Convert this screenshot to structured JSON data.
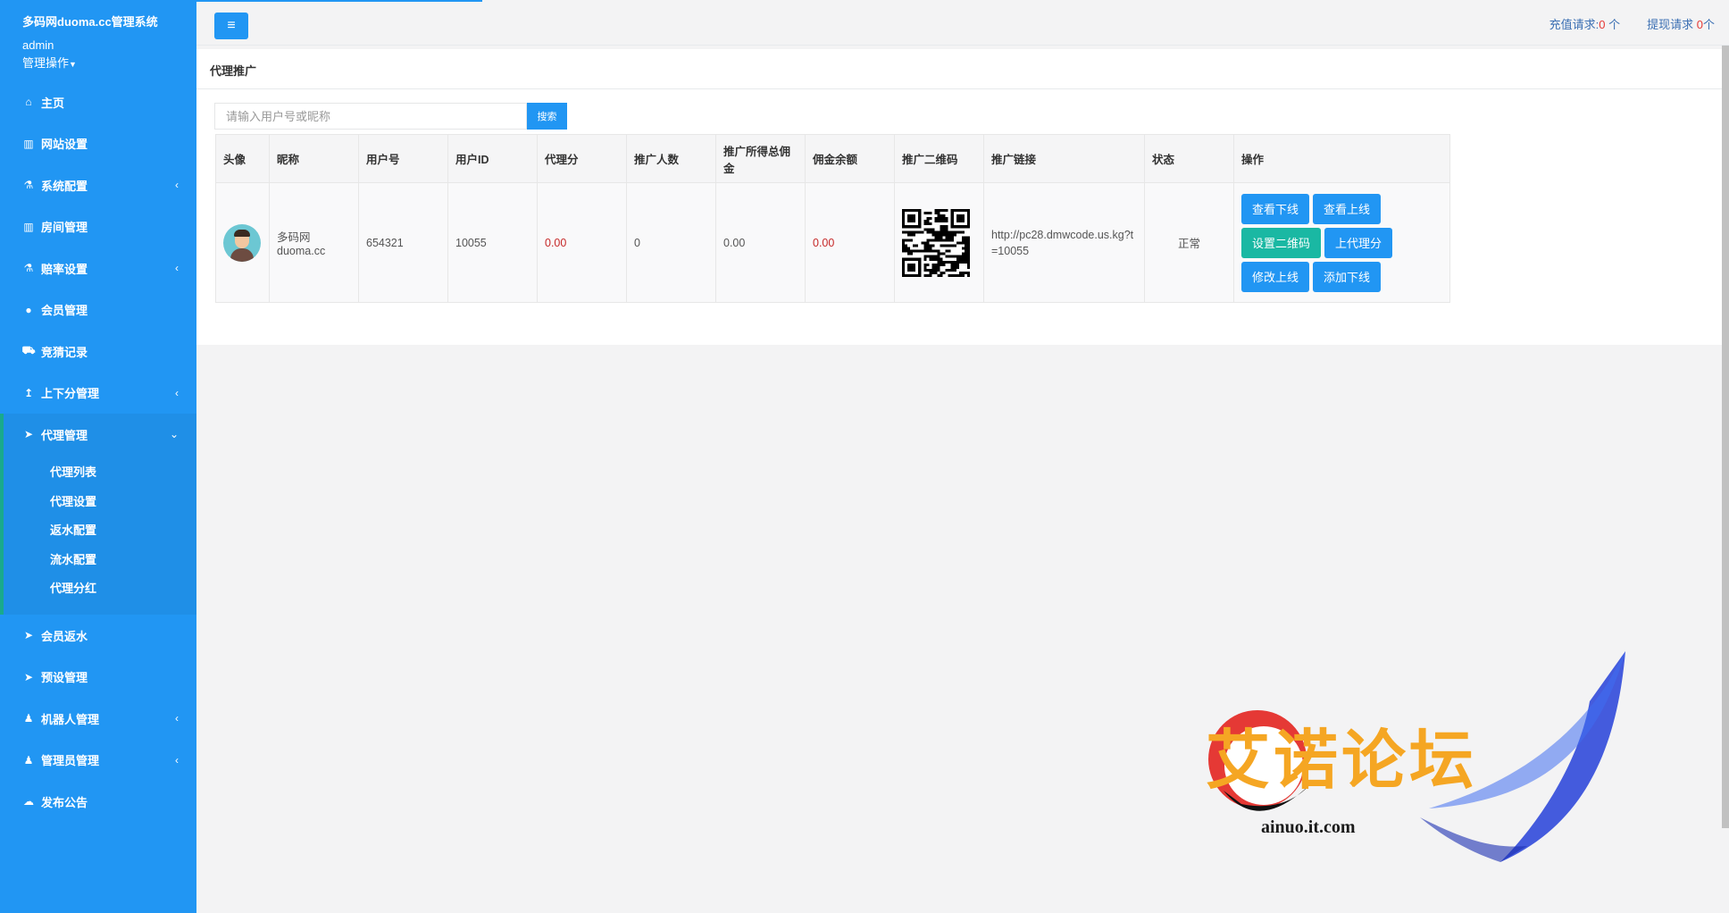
{
  "sidebar": {
    "title": "多码网duoma.cc管理系统",
    "user": "admin",
    "ops_label": "管理操作",
    "items": [
      {
        "label": "主页",
        "icon": "home-icon",
        "glyph": "⌂",
        "chevron": ""
      },
      {
        "label": "网站设置",
        "icon": "columns-icon",
        "glyph": "▥",
        "chevron": ""
      },
      {
        "label": "系统配置",
        "icon": "flask-icon",
        "glyph": "⚗",
        "chevron": "‹"
      },
      {
        "label": "房间管理",
        "icon": "columns-icon",
        "glyph": "▥",
        "chevron": ""
      },
      {
        "label": "赔率设置",
        "icon": "flask-icon",
        "glyph": "⚗",
        "chevron": "‹"
      },
      {
        "label": "会员管理",
        "icon": "user-icon",
        "glyph": "●",
        "chevron": ""
      },
      {
        "label": "竞猜记录",
        "icon": "car-icon",
        "glyph": "⛟",
        "chevron": ""
      },
      {
        "label": "上下分管理",
        "icon": "upload-icon",
        "glyph": "↥",
        "chevron": "‹"
      },
      {
        "label": "代理管理",
        "icon": "paper-plane-icon",
        "glyph": "➤",
        "chevron": "⌄"
      }
    ],
    "sub_items": [
      "代理列表",
      "代理设置",
      "返水配置",
      "流水配置",
      "代理分红"
    ],
    "items_after": [
      {
        "label": "会员返水",
        "icon": "paper-plane-icon",
        "glyph": "➤",
        "chevron": ""
      },
      {
        "label": "预设管理",
        "icon": "paper-plane-icon",
        "glyph": "➤",
        "chevron": ""
      },
      {
        "label": "机器人管理",
        "icon": "male-icon",
        "glyph": "♟",
        "chevron": "‹"
      },
      {
        "label": "管理员管理",
        "icon": "male-icon",
        "glyph": "♟",
        "chevron": "‹"
      },
      {
        "label": "发布公告",
        "icon": "comment-icon",
        "glyph": "☁",
        "chevron": ""
      }
    ]
  },
  "topbar": {
    "recharge_label": "充值请求:",
    "recharge_count": "0",
    "recharge_unit": "个",
    "withdraw_label": "提现请求",
    "withdraw_count": "0",
    "withdraw_unit": "个"
  },
  "page": {
    "title": "代理推广",
    "search_placeholder": "请输入用户号或昵称",
    "search_button": "搜索"
  },
  "table": {
    "headers": [
      "头像",
      "昵称",
      "用户号",
      "用户ID",
      "代理分",
      "推广人数",
      "推广所得总佣金",
      "佣金余额",
      "推广二维码",
      "推广链接",
      "状态",
      "操作"
    ],
    "rows": [
      {
        "nickname_line1": "多码网",
        "nickname_line2": "duoma.cc",
        "user_no": "654321",
        "user_id": "10055",
        "agent_points": "0.00",
        "promo_count": "0",
        "total_commission": "0.00",
        "commission_balance": "0.00",
        "link": "http://pc28.dmwcode.us.kg?t=10055",
        "status": "正常",
        "actions": [
          "查看下线",
          "查看上线",
          "设置二维码",
          "上代理分",
          "修改上线",
          "添加下线"
        ]
      }
    ]
  },
  "watermark": {
    "text": "艾诺论坛",
    "url": "ainuo.it.com"
  },
  "colors": {
    "accent": "#2196f3",
    "active_border": "#19aa8d",
    "red_value": "#c62828",
    "green_button": "#1ab8a3"
  }
}
